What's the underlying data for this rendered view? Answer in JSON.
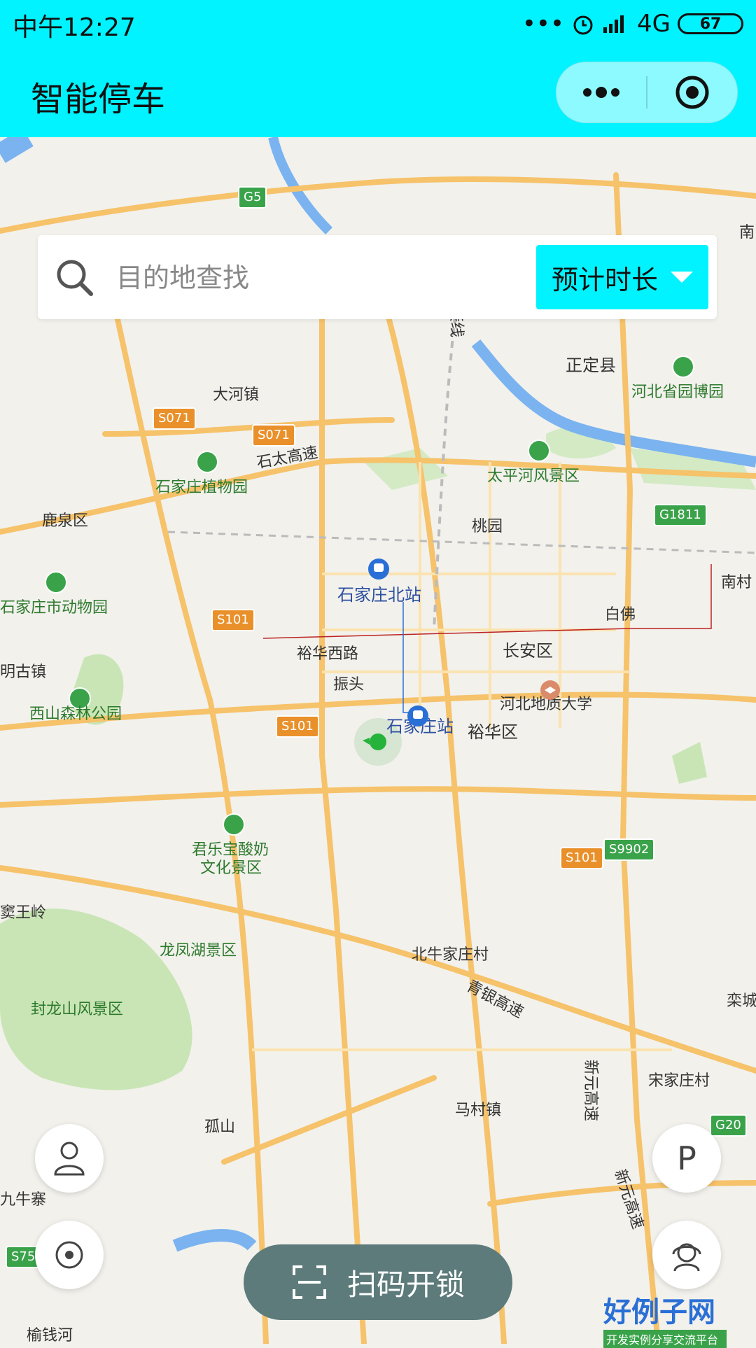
{
  "status_bar": {
    "time": "中午12:27",
    "network": "4G",
    "battery": "67"
  },
  "nav": {
    "title": "智能停车"
  },
  "search": {
    "placeholder": "目的地查找",
    "duration_label": "预计时长"
  },
  "map": {
    "labels": {
      "zhengding": "正定县",
      "hebei_museum": "河北省园博园",
      "dahe": "大河镇",
      "plant": "石家庄植物园",
      "taipinghe": "太平河风景区",
      "luquan": "鹿泉区",
      "taoyuan": "桃园",
      "zoo": "石家庄市动物园",
      "north_station": "石家庄北站",
      "baifo": "白佛",
      "yuhua_west": "裕华西路",
      "changan": "长安区",
      "minggu": "明古镇",
      "zhentou": "振头",
      "geo_univ": "河北地质大学",
      "xishan": "西山森林公园",
      "station": "石家庄站",
      "yuhua": "裕华区",
      "junlebao_1": "君乐宝酸奶",
      "junlebao_2": "文化景区",
      "yaowangling": "窦王岭",
      "longfeng": "龙凤湖景区",
      "beiniu": "北牛家庄村",
      "fenglong": "封龙山风景区",
      "qingyin": "青银高速",
      "xinyuan1": "新元高速",
      "songjia": "宋家庄村",
      "gushan": "孤山",
      "macun": "马村镇",
      "xinyuan2": "新元高速",
      "jiuniu": "九牛寨",
      "yuqian": "榆钱河",
      "nancun": "南村",
      "luancheng": "栾城",
      "shitai": "石太高速",
      "gaosu_link": "高速连接线",
      "nan": "南"
    },
    "road_signs": {
      "g5": "G5",
      "s071a": "S071",
      "s071b": "S071",
      "s101a": "S101",
      "s101b": "S101",
      "s101c": "S101",
      "s9902": "S9902",
      "g1811": "G1811",
      "g20": "G20",
      "s75": "S75"
    }
  },
  "buttons": {
    "scan": "扫码开锁",
    "parking": "P"
  },
  "watermark": {
    "title": "好例子网",
    "subtitle": "开发实例分享交流平台"
  },
  "colors": {
    "accent": "#00f3ff",
    "scan_bg": "#5d7b7b",
    "road": "#f6c26a"
  }
}
